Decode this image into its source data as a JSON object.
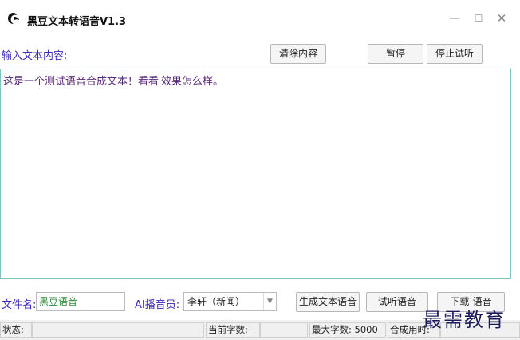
{
  "app": {
    "title": "黑豆文本转语音V1.3",
    "logo_icon": "app-logo-icon"
  },
  "window": {
    "min_glyph": "—",
    "max_glyph": "☐",
    "close_glyph": "✕"
  },
  "input": {
    "label": "输入文本内容:",
    "text": "这是一个测试语音合成文本！看看",
    "text_after_caret": "效果怎么样。"
  },
  "toolbar": {
    "clear_label": "清除内容",
    "pause_label": "暂停",
    "stop_label": "停止试听"
  },
  "file": {
    "label": "文件名:",
    "value": "黑豆语音"
  },
  "voice": {
    "label": "AI播音员:",
    "selected": "李轩（新闻）"
  },
  "actions": {
    "generate_label": "生成文本语音",
    "listen_label": "试听语音",
    "download_label": "下载-语音"
  },
  "status": {
    "state_label": "状态:",
    "state_value": "",
    "current_chars_label": "当前字数:",
    "current_chars_value": "",
    "max_chars_label": "最大字数: 5000",
    "synth_time_label": "合成用时:",
    "synth_time_value": ""
  },
  "watermark": "最需教育",
  "colors": {
    "label_purple": "#3a2ab8",
    "text_purple": "#5a2a7a",
    "filename_green": "#2e8a3a",
    "textarea_border": "#7fc3c0"
  }
}
